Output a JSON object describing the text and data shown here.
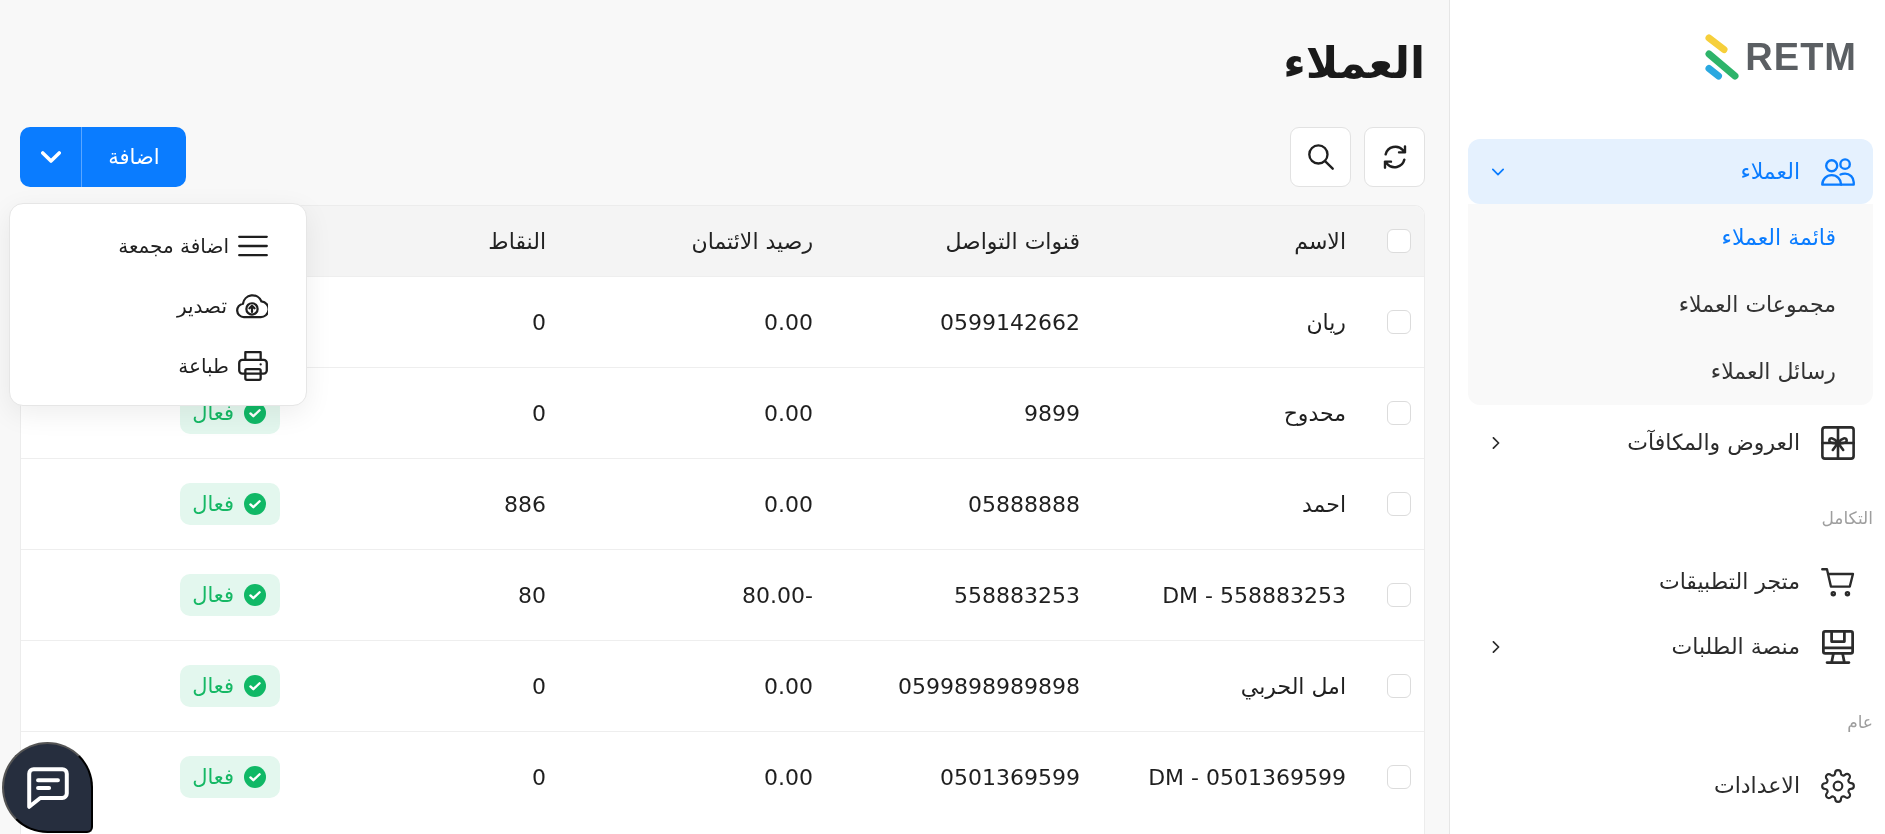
{
  "sidebar": {
    "logo_text": "RETM",
    "sections": [
      {
        "items": [
          {
            "kind": "group",
            "label": "العملاء",
            "selected": true,
            "expanded": true,
            "children": [
              {
                "label": "قائمة العملاء",
                "selected": true
              },
              {
                "label": "مجموعات العملاء",
                "selected": false
              },
              {
                "label": "رسائل العملاء",
                "selected": false
              }
            ]
          },
          {
            "kind": "group",
            "label": "العروض والمكافآت",
            "selected": false,
            "expanded": false
          }
        ]
      },
      {
        "title": "التكامل",
        "items": [
          {
            "kind": "link",
            "label": "متجر التطبيقات",
            "selected": false
          },
          {
            "kind": "group",
            "label": "منصة الطلبات",
            "selected": false,
            "expanded": false
          }
        ]
      },
      {
        "title": "عام",
        "items": [
          {
            "kind": "link",
            "label": "الاعدادات",
            "selected": false
          }
        ]
      }
    ]
  },
  "page": {
    "title": "العملاء"
  },
  "toolbar": {
    "add_button": {
      "label": "اضافة"
    }
  },
  "add_menu": {
    "items": [
      {
        "label": "اضافة مجمعة"
      },
      {
        "label": "تصدير"
      },
      {
        "label": "طباعة"
      }
    ]
  },
  "table": {
    "select_all": {
      "checked": false
    },
    "columns": [
      "الاسم",
      "قنوات التواصل",
      "رصيد الائتمان",
      "النقاط"
    ],
    "rows": [
      {
        "checked": false,
        "name": "ريان",
        "channels": "0599142662",
        "credit": "0.00",
        "points": "0"
      },
      {
        "checked": false,
        "name": "محدوح",
        "channels": "9899",
        "credit": "0.00",
        "points": "0",
        "badge": {
          "label": "فعال",
          "kind": "active"
        }
      },
      {
        "checked": false,
        "name": "احمد",
        "channels": "05888888",
        "credit": "0.00",
        "points": "886",
        "badge": {
          "label": "فعال",
          "kind": "active"
        }
      },
      {
        "checked": false,
        "name": "DM - 558883253",
        "channels": "558883253",
        "credit": "80.00-",
        "points": "80",
        "badge": {
          "label": "فعال",
          "kind": "active"
        }
      },
      {
        "checked": false,
        "name": "امل الحربي",
        "channels": "0599898989898",
        "credit": "0.00",
        "points": "0",
        "badge": {
          "label": "فعال",
          "kind": "active"
        }
      },
      {
        "checked": false,
        "name": "DM - 0501369599",
        "channels": "0501369599",
        "credit": "0.00",
        "points": "0",
        "badge": {
          "label": "فعال",
          "kind": "active"
        }
      }
    ]
  }
}
